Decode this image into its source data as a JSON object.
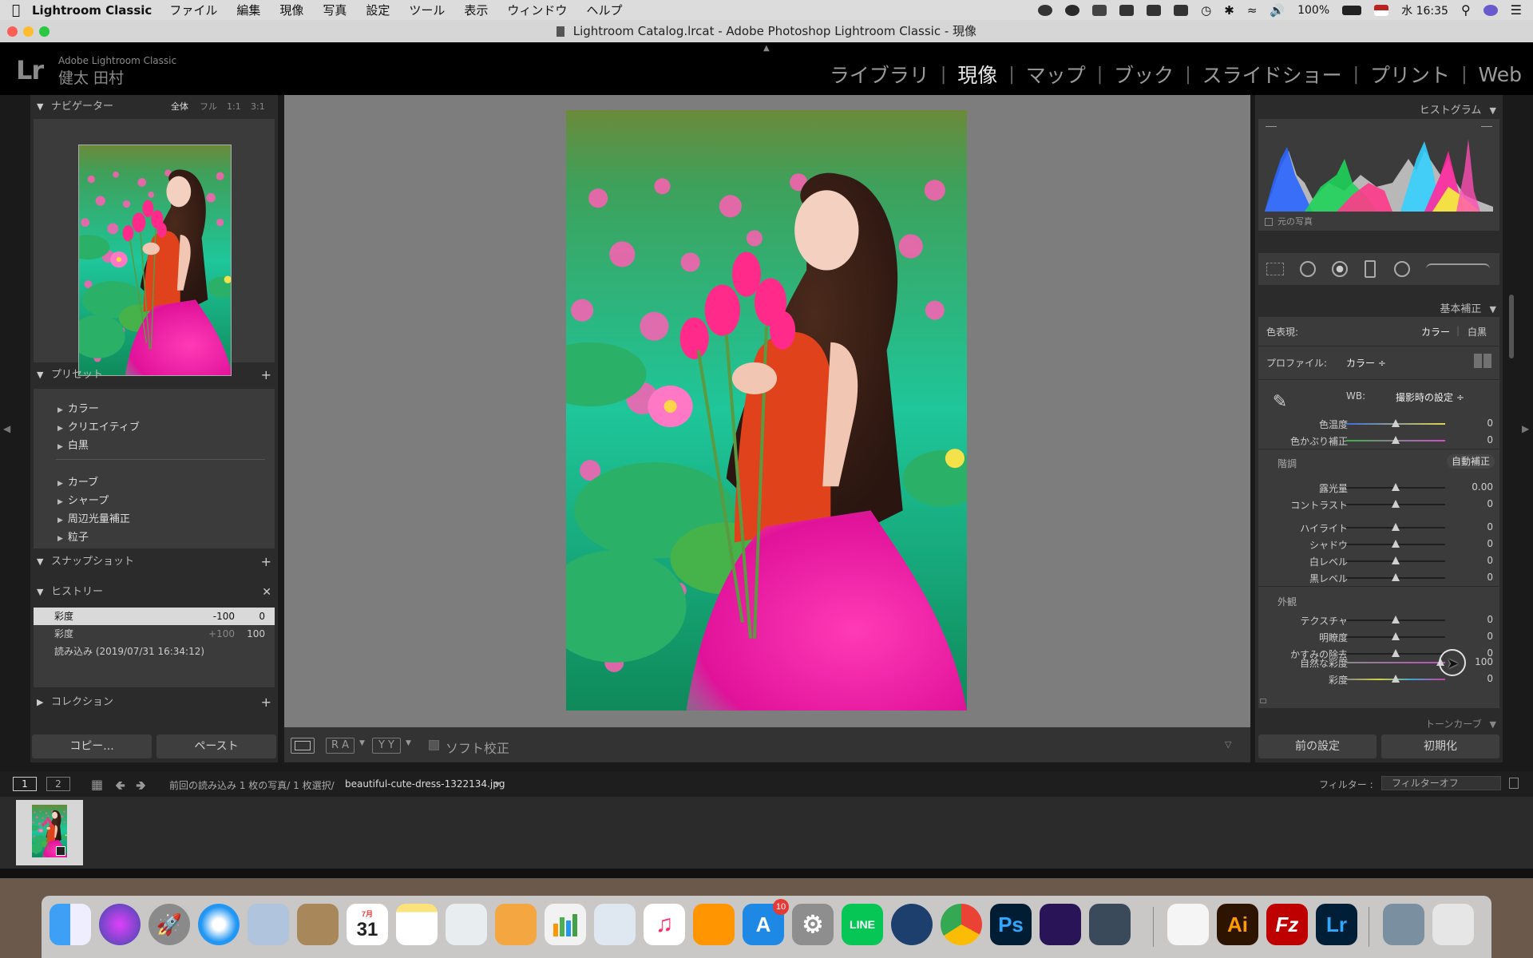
{
  "menubar": {
    "app_name": "Lightroom Classic",
    "items": [
      "ファイル",
      "編集",
      "現像",
      "写真",
      "設定",
      "ツール",
      "表示",
      "ウィンドウ",
      "ヘルプ"
    ],
    "battery": "100%",
    "clock": "水 16:35"
  },
  "window": {
    "title": "Lightroom Catalog.lrcat - Adobe Photoshop Lightroom Classic - 現像"
  },
  "identity": {
    "logo": "Lr",
    "product": "Adobe Lightroom Classic",
    "user": "健太 田村"
  },
  "modules": [
    "ライブラリ",
    "現像",
    "マップ",
    "ブック",
    "スライドショー",
    "プリント",
    "Web"
  ],
  "left": {
    "navigator": {
      "title": "ナビゲーター",
      "zoom": [
        "全体",
        "フル",
        "1:1",
        "3:1"
      ]
    },
    "presets": {
      "title": "プリセット",
      "group1": [
        "カラー",
        "クリエイティブ",
        "白黒"
      ],
      "group2": [
        "カーブ",
        "シャープ",
        "周辺光量補正",
        "粒子"
      ]
    },
    "snapshots": {
      "title": "スナップショット"
    },
    "history": {
      "title": "ヒストリー",
      "rows": [
        {
          "label": "彩度",
          "delta": "-100",
          "value": "0"
        },
        {
          "label": "彩度",
          "delta": "+100",
          "value": "100"
        },
        {
          "label": "読み込み (2019/07/31 16:34:12)",
          "delta": "",
          "value": ""
        }
      ]
    },
    "collections": {
      "title": "コレクション"
    },
    "copy_btn": "コピー...",
    "paste_btn": "ペースト"
  },
  "toolbar": {
    "ra": "R A",
    "yy": "Y Y",
    "softproof": "ソフト校正"
  },
  "right": {
    "histogram_title": "ヒストグラム",
    "original_photo": "元の写真",
    "basic_title": "基本補正",
    "treatment_label": "色表現:",
    "treatment_color": "カラー",
    "treatment_bw": "白黒",
    "profile_label": "プロファイル:",
    "profile_value": "カラー ÷",
    "wb_label": "WB:",
    "wb_value": "撮影時の設定 ÷",
    "tone_head": "階調",
    "auto_btn": "自動補正",
    "presence_head": "外観",
    "tone_curve": "トーンカーブ",
    "sliders_wb": [
      {
        "label": "色温度",
        "value": "0",
        "pos": 0.5
      },
      {
        "label": "色かぶり補正",
        "value": "0",
        "pos": 0.5
      }
    ],
    "sliders_tone": [
      {
        "label": "露光量",
        "value": "0.00",
        "pos": 0.5
      },
      {
        "label": "コントラスト",
        "value": "0",
        "pos": 0.5
      }
    ],
    "sliders_tone2": [
      {
        "label": "ハイライト",
        "value": "0",
        "pos": 0.5
      },
      {
        "label": "シャドウ",
        "value": "0",
        "pos": 0.5
      },
      {
        "label": "白レベル",
        "value": "0",
        "pos": 0.5
      },
      {
        "label": "黒レベル",
        "value": "0",
        "pos": 0.5
      }
    ],
    "sliders_presence": [
      {
        "label": "テクスチャ",
        "value": "0",
        "pos": 0.5
      },
      {
        "label": "明瞭度",
        "value": "0",
        "pos": 0.5
      },
      {
        "label": "かすみの除去",
        "value": "0",
        "pos": 0.5
      }
    ],
    "sliders_presence2": [
      {
        "label": "自然な彩度",
        "value": "100",
        "pos": 0.95
      },
      {
        "label": "彩度",
        "value": "0",
        "pos": 0.5
      }
    ],
    "prev_btn": "前の設定",
    "reset_btn": "初期化"
  },
  "filmbar": {
    "page1": "1",
    "page2": "2",
    "source": "前回の読み込み  1 枚の写真/ 1 枚選択/",
    "filename": "beautiful-cute-dress-1322134.jpg",
    "filter_label": "フィルター :",
    "filter_value": "フィルターオフ"
  },
  "dock": {
    "calendar_month": "7月",
    "calendar_day": "31",
    "appstore_badge": "10",
    "line_label": "LINE",
    "ps": "Ps",
    "ai": "Ai",
    "fz": "Fz",
    "lr": "Lr"
  }
}
